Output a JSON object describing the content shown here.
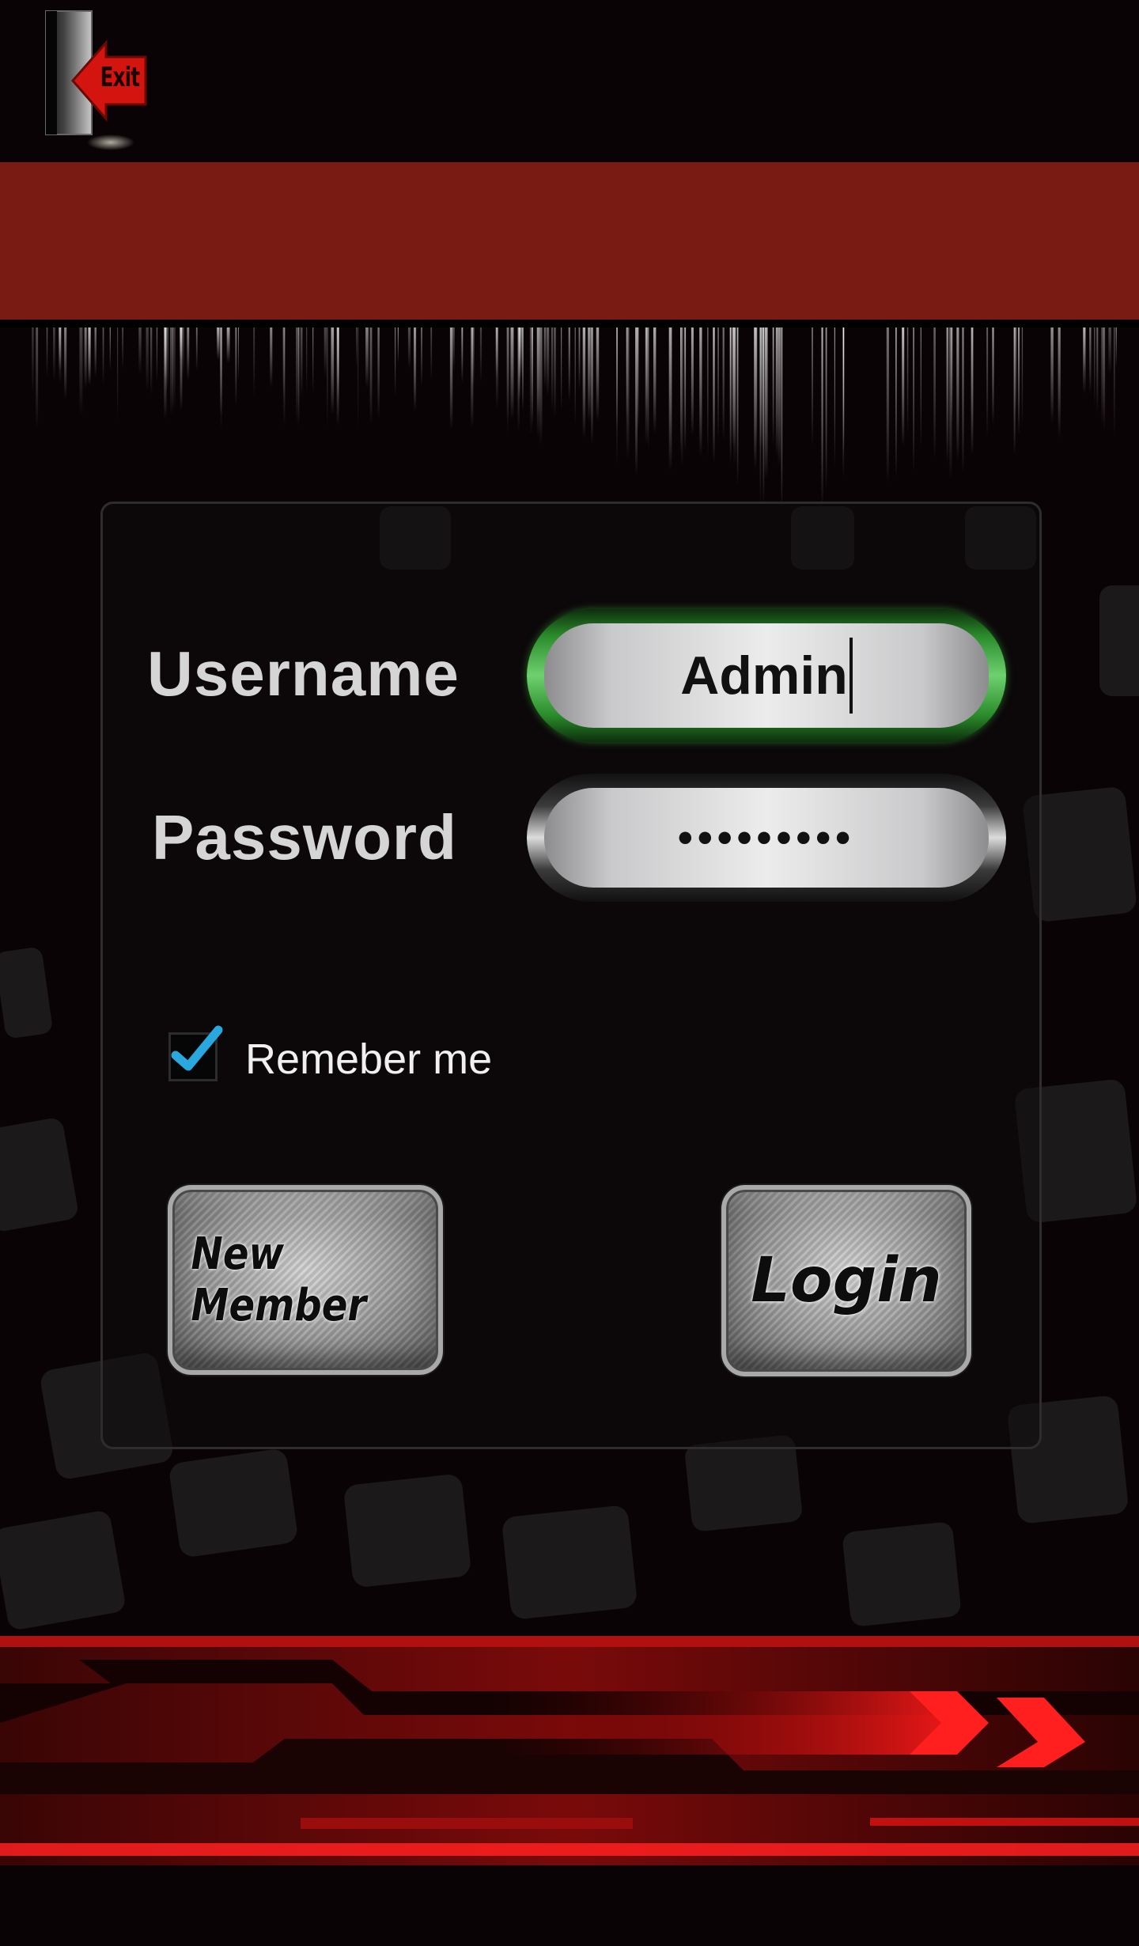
{
  "header": {
    "exit_label": "Exit"
  },
  "login_form": {
    "username_label": "Username",
    "username_value": "Admin",
    "password_label": "Password",
    "password_mask": "•••••••••",
    "remember_label": "Remeber me",
    "remember_checked": true,
    "new_member_label": "New Member",
    "login_label": "Login"
  },
  "colors": {
    "background": "#0a0305",
    "title_band": "#7a1b13",
    "active_field_ring": "#2a8b2a",
    "checkbox_accent": "#29a8e0",
    "bottom_accent": "#e01010"
  }
}
